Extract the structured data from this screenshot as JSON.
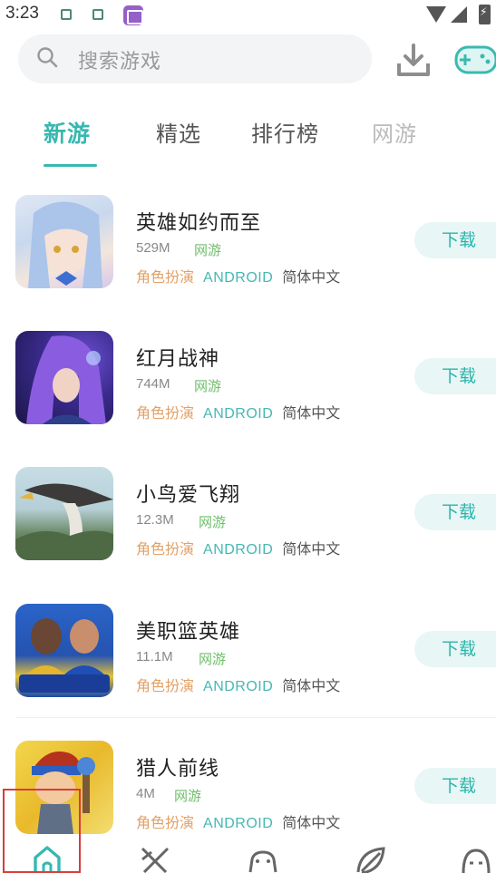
{
  "status_bar": {
    "time": "3:23",
    "icons": [
      "notification-icon",
      "notification-icon",
      "app-icon",
      "wifi-icon",
      "signal-icon",
      "battery-icon"
    ]
  },
  "header": {
    "search_placeholder": "搜索游戏",
    "icons": [
      "search-icon",
      "download-icon",
      "gamepad-icon"
    ]
  },
  "tabs": [
    {
      "label": "新游",
      "active": true
    },
    {
      "label": "精选",
      "active": false
    },
    {
      "label": "排行榜",
      "active": false
    },
    {
      "label": "网游",
      "active": false
    }
  ],
  "games": [
    {
      "name": "英雄如约而至",
      "size": "529M",
      "net": "网游",
      "genre": "角色扮演",
      "platform": "ANDROID",
      "language": "简体中文",
      "button": "下载"
    },
    {
      "name": "红月战神",
      "size": "744M",
      "net": "网游",
      "genre": "角色扮演",
      "platform": "ANDROID",
      "language": "简体中文",
      "button": "下载"
    },
    {
      "name": "小鸟爱飞翔",
      "size": "12.3M",
      "net": "网游",
      "genre": "角色扮演",
      "platform": "ANDROID",
      "language": "简体中文",
      "button": "下载"
    },
    {
      "name": "美职篮英雄",
      "size": "11.1M",
      "net": "网游",
      "genre": "角色扮演",
      "platform": "ANDROID",
      "language": "简体中文",
      "button": "下载"
    },
    {
      "name": "猎人前线",
      "size": "4M",
      "net": "网游",
      "genre": "角色扮演",
      "platform": "ANDROID",
      "language": "简体中文",
      "button": "下载"
    }
  ],
  "bottom_nav": {
    "items": [
      "home-icon",
      "sword-icon",
      "controller-icon",
      "leaf-icon",
      "face-icon"
    ],
    "active": "home-icon"
  },
  "colors": {
    "accent": "#37b8b0",
    "genre": "#e3a066",
    "network": "#6fbf6a",
    "button_bg": "#e8f7f6",
    "highlight": "#d93b3b"
  }
}
